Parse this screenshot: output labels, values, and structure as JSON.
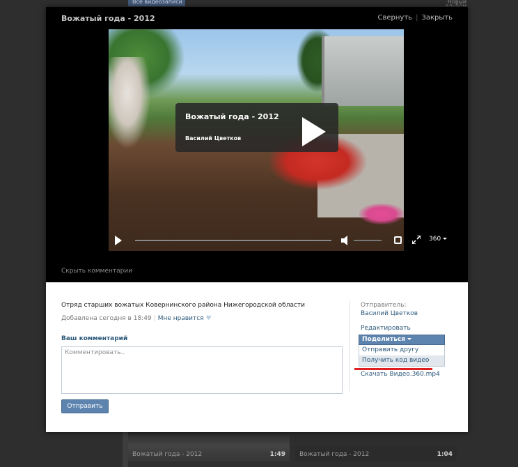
{
  "background": {
    "tab_left": "Все видеозаписи",
    "tab_right": "Новый альбом",
    "thumbs": [
      {
        "title": "Вожатый года - 2012",
        "duration": "1:49"
      },
      {
        "title": "Вожатый года - 2012",
        "duration": "1:04"
      }
    ]
  },
  "modal": {
    "title": "Вожатый года - 2012",
    "minimize_label": "Свернуть",
    "close_label": "Закрыть"
  },
  "player": {
    "overlay_title": "Вожатый года - 2012",
    "overlay_author": "Василий Цветков",
    "quality": "360",
    "hide_comments": "Скрыть комментарии"
  },
  "info": {
    "description": "Отряд старших вожатых Ковернинского района Нижегородской области",
    "added": "Добавлена сегодня в 18:49",
    "like_label": "Мне нравится",
    "comment_label": "Ваш комментарий",
    "comment_placeholder": "Комментировать..",
    "send_label": "Отправить"
  },
  "sidebar": {
    "sender_label": "Отправитель:",
    "sender_name": "Василий Цветков",
    "edit_label": "Редактировать",
    "share_label": "Поделиться",
    "share_menu": [
      "Отправить другу",
      "Получить код видео"
    ],
    "download_label": "Скачать Видео.360.mp4"
  },
  "colors": {
    "accent": "#5d84ae",
    "link": "#2b587a",
    "highlight": "#e02020"
  }
}
